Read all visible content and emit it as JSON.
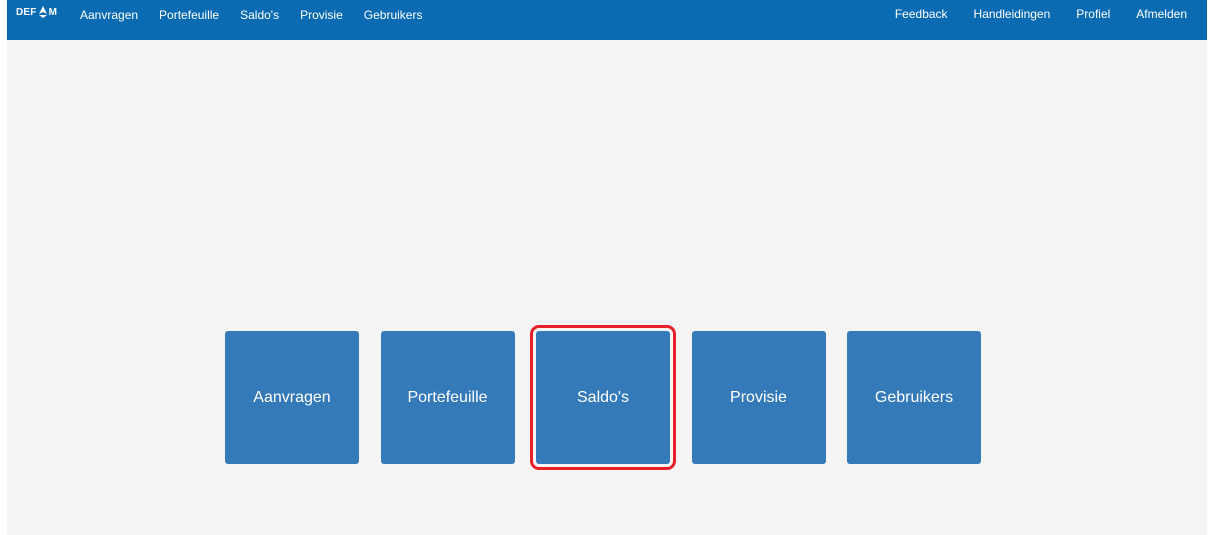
{
  "header": {
    "logo": {
      "text_left": "DEF",
      "text_right": "M",
      "icon": "defam-logo-icon"
    },
    "nav_left": [
      {
        "label": "Aanvragen"
      },
      {
        "label": "Portefeuille"
      },
      {
        "label": "Saldo's"
      },
      {
        "label": "Provisie"
      },
      {
        "label": "Gebruikers"
      }
    ],
    "nav_right": [
      {
        "label": "Feedback"
      },
      {
        "label": "Handleidingen"
      },
      {
        "label": "Profiel"
      },
      {
        "label": "Afmelden"
      }
    ]
  },
  "tiles": [
    {
      "label": "Aanvragen",
      "selected": false
    },
    {
      "label": "Portefeuille",
      "selected": false
    },
    {
      "label": "Saldo's",
      "selected": true
    },
    {
      "label": "Provisie",
      "selected": false
    },
    {
      "label": "Gebruikers",
      "selected": false
    }
  ],
  "colors": {
    "header_bg": "#0a6bb3",
    "tile_bg": "#357ab8",
    "page_bg": "#f4f4f4",
    "highlight": "#e8202a"
  }
}
